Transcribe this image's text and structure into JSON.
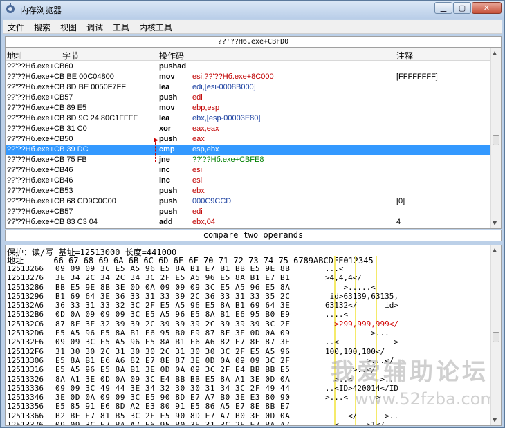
{
  "window": {
    "title": "内存浏览器",
    "min": "▁",
    "max": "▢",
    "close": "✕"
  },
  "menu": [
    "文件",
    "搜索",
    "视图",
    "调试",
    "工具",
    "内核工具"
  ],
  "address_bar": "??'??Hб.exe+CBFD0",
  "disasm": {
    "headers": {
      "addr": "地址",
      "bytes": "字节",
      "opcode": "操作码",
      "comment": "注释"
    },
    "rows": [
      {
        "addr": "??'??Hб.exe+CB60",
        "op": "pushad",
        "arg": "",
        "cmt": "",
        "argc": ""
      },
      {
        "addr": "??'??Hб.exe+CB BE 00C04800",
        "op": "mov",
        "arg": "esi,??'??Hб.exe+8C000",
        "cmt": "[FFFFFFFF]",
        "argc": ""
      },
      {
        "addr": "??'??Hб.exe+CB 8D BE 0050F7FF",
        "op": "lea",
        "arg": "edi,[esi-0008B000]",
        "cmt": "",
        "argc": "blue"
      },
      {
        "addr": "??'??Hб.exe+CB57",
        "op": "push",
        "arg": "edi",
        "cmt": "",
        "argc": ""
      },
      {
        "addr": "??'??Hб.exe+CB 89 E5",
        "op": "mov",
        "arg": "ebp,esp",
        "cmt": "",
        "argc": ""
      },
      {
        "addr": "??'??Hб.exe+CB 8D 9C 24 80C1FFFF",
        "op": "lea",
        "arg": "ebx,[esp-00003E80]",
        "cmt": "",
        "argc": "blue"
      },
      {
        "addr": "??'??Hб.exe+CB 31 C0",
        "op": "xor",
        "arg": "eax,eax",
        "cmt": "",
        "argc": ""
      },
      {
        "addr": "??'??Hб.exe+CB50",
        "op": "push",
        "arg": "eax",
        "cmt": "",
        "argc": ""
      },
      {
        "addr": "??'??Hб.exe+CB 39 DC",
        "op": "cmp",
        "arg": "esp,ebx",
        "cmt": "",
        "argc": "",
        "sel": true
      },
      {
        "addr": "??'??Hб.exe+CB 75 FB",
        "op": "jne",
        "arg": "??'??Hб.exe+CBFE8",
        "cmt": "",
        "argc": "green"
      },
      {
        "addr": "??'??Hб.exe+CB46",
        "op": "inc",
        "arg": "esi",
        "cmt": "",
        "argc": ""
      },
      {
        "addr": "??'??Hб.exe+CB46",
        "op": "inc",
        "arg": "esi",
        "cmt": "",
        "argc": ""
      },
      {
        "addr": "??'??Hб.exe+CB53",
        "op": "push",
        "arg": "ebx",
        "cmt": "",
        "argc": ""
      },
      {
        "addr": "??'??Hб.exe+CB 68 CD9C0C00",
        "op": "push",
        "arg": "000C9CCD",
        "cmt": "[0]",
        "argc": "blue"
      },
      {
        "addr": "??'??Hб.exe+CB57",
        "op": "push",
        "arg": "edi",
        "cmt": "",
        "argc": ""
      },
      {
        "addr": "??'??Hб.exe+CB 83 C3 04",
        "op": "add",
        "arg": "ebx,04",
        "cmt": "4",
        "argc": ""
      }
    ]
  },
  "status_text": "compare two operands",
  "hex": {
    "info": "保护：读/写   基址=12513000 长度=441000",
    "header": "地址      66 67 68 69 6A 6B 6C 6D 6E 6F 70 71 72 73 74 75 6789ABCDEF012345",
    "rows": [
      {
        "a": "12513266",
        "b": "09 09 09 3C E5 A5 96 E5 8A B1 E7 B1 BB E5 9E 8B",
        "t": "...<"
      },
      {
        "a": "12513276",
        "b": "3E 34 2C 34 2C 34 3C 2F E5 A5 96 E5 8A B1 E7 B1",
        "t": ">4,4,4</"
      },
      {
        "a": "12513286",
        "b": "BB E5 9E 8B 3E 0D 0A 09 09 09 3C E5 A5 96 E5 8A",
        "t": "    >.....<"
      },
      {
        "a": "12513296",
        "b": "B1 69 64 3E 36 33 31 33 39 2C 36 33 31 33 35 2C",
        "t": " id>63139,63135,"
      },
      {
        "a": "125132A6",
        "b": "36 33 31 33 32 3C 2F E5 A5 96 E5 8A B1 69 64 3E",
        "t": "63132</      id>"
      },
      {
        "a": "125132B6",
        "b": "0D 0A 09 09 09 3C E5 A5 96 E5 8A B1 E6 95 B0 E9",
        "t": "....<"
      },
      {
        "a": "125132C6",
        "b": "87 8F 3E 32 39 39 2C 39 39 39 2C 39 39 39 3C 2F",
        "t": "  >299,999,999</",
        "red": true
      },
      {
        "a": "125132D6",
        "b": "E5 A5 96 E5 8A B1 E6 95 B0 E9 87 8F 3E 0D 0A 09",
        "t": "          >..."
      },
      {
        "a": "125132E6",
        "b": "09 09 3C E5 A5 96 E5 8A B1 E6 A6 82 E7 8E 87 3E",
        "t": "..<            >"
      },
      {
        "a": "125132F6",
        "b": "31 30 30 2C 31 30 30 2C 31 30 30 3C 2F E5 A5 96",
        "t": "100,100,100</"
      },
      {
        "a": "12513306",
        "b": "E5 8A B1 E6 A6 82 E7 8E 87 3E 0D 0A 09 09 3C 2F",
        "t": "         >...</"
      },
      {
        "a": "12513316",
        "b": "E5 A5 96 E5 8A B1 3E 0D 0A 09 3C 2F E4 BB BB E5",
        "t": "      >..</"
      },
      {
        "a": "12513326",
        "b": "8A A1 3E 0D 0A 09 3C E4 BB BB E5 8A A1 3E 0D 0A",
        "t": "  >..<      >.."
      },
      {
        "a": "12513336",
        "b": "09 09 3C 49 44 3E 34 32 30 30 31 34 3C 2F 49 44",
        "t": "..<ID>420014</ID"
      },
      {
        "a": "12513346",
        "b": "3E 0D 0A 09 09 3C E5 90 8D E7 A7 B0 3E E3 80 90",
        "t": ">...<      >"
      },
      {
        "a": "12513356",
        "b": "E5 85 91 E6 8D A2 E3 80 91 E5 86 A5 E7 8E 8B E7",
        "t": ""
      },
      {
        "a": "12513366",
        "b": "B2 BE E7 81 B5 3C 2F E5 90 8D E7 A7 B0 3E 0D 0A",
        "t": "     </      >.."
      },
      {
        "a": "12513376",
        "b": "09 09 3C E7 BA A7 E6 95 B0 3E 31 3C 2F E7 BA A7",
        "t": "..<      >1</"
      }
    ]
  },
  "watermark": {
    "cn": "我爱辅助论坛",
    "url": "www.52fzba.com"
  }
}
